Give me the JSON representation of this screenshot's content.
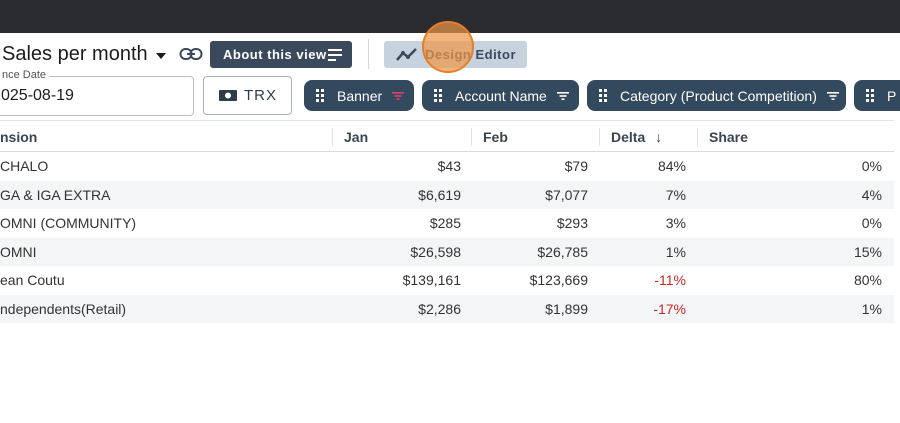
{
  "header": {
    "view_title": "Sales per month",
    "about_label": "About this view",
    "design_label": "Design Editor"
  },
  "filters": {
    "date_label": "nce Date",
    "date_value": "025-08-19",
    "trx_label": "TRX",
    "chips": [
      "Banner",
      "Account Name",
      "Category (Product Competition)",
      "P"
    ]
  },
  "table": {
    "columns": [
      "nsion",
      "Jan",
      "Feb",
      "Delta",
      "Share"
    ],
    "sort_indicator": "↓",
    "rows": [
      {
        "dimension": "CHALO",
        "jan": "$43",
        "feb": "$79",
        "delta": "84%",
        "share": "0%",
        "negative": false
      },
      {
        "dimension": "GA & IGA EXTRA",
        "jan": "$6,619",
        "feb": "$7,077",
        "delta": "7%",
        "share": "4%",
        "negative": false
      },
      {
        "dimension": "OMNI (COMMUNITY)",
        "jan": "$285",
        "feb": "$293",
        "delta": "3%",
        "share": "0%",
        "negative": false
      },
      {
        "dimension": "OMNI",
        "jan": "$26,598",
        "feb": "$26,785",
        "delta": "1%",
        "share": "15%",
        "negative": false
      },
      {
        "dimension": "ean Coutu",
        "jan": "$139,161",
        "feb": "$123,669",
        "delta": "-11%",
        "share": "80%",
        "negative": true
      },
      {
        "dimension": "ndependents(Retail)",
        "jan": "$2,286",
        "feb": "$1,899",
        "delta": "-17%",
        "share": "1%",
        "negative": true
      }
    ]
  },
  "colors": {
    "topbar": "#2b2c30",
    "button_dark": "#3a4a5c",
    "chip": "#33495e",
    "design_button": "#c6d3df",
    "highlight": "#f0964b",
    "negative": "#c62828",
    "filter_active": "#e0406e"
  },
  "icons": [
    "link-icon",
    "lines-icon",
    "chart-line-icon",
    "cash-icon",
    "grip-icon",
    "filter-icon",
    "caret-down-icon",
    "sort-down-icon"
  ]
}
